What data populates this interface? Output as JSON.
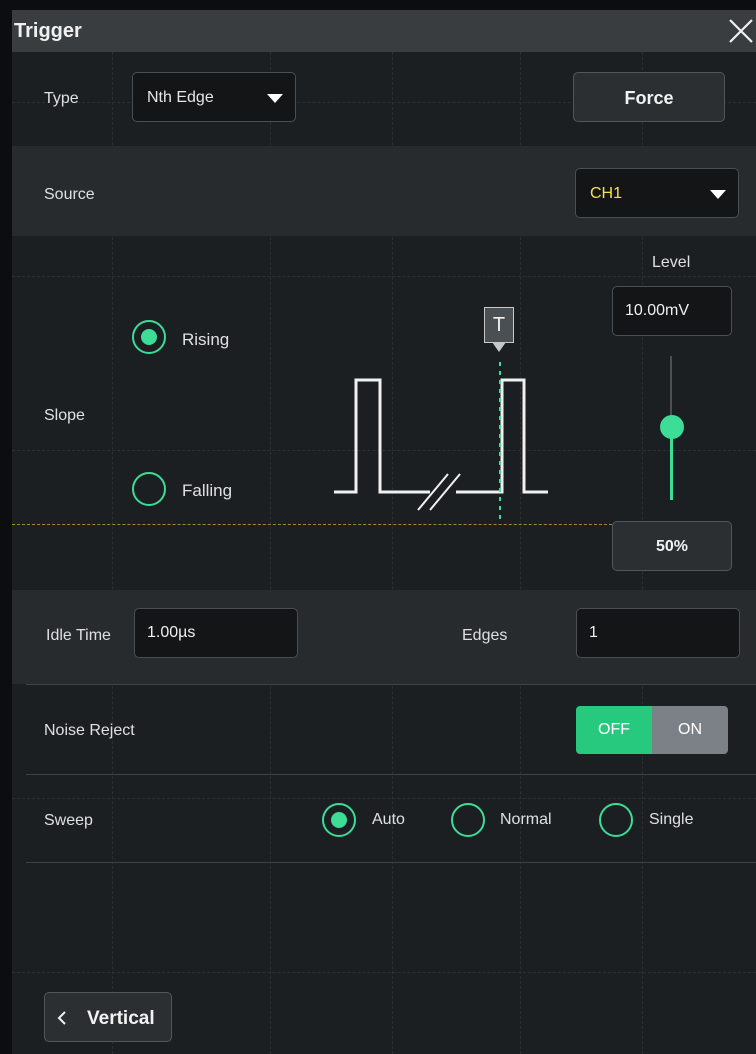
{
  "title": "Trigger",
  "type": {
    "label": "Type",
    "value": "Nth Edge"
  },
  "force_label": "Force",
  "source": {
    "label": "Source",
    "value": "CH1",
    "value_color": "#f4e04d"
  },
  "slope": {
    "label": "Slope",
    "options": [
      {
        "label": "Rising",
        "selected": true
      },
      {
        "label": "Falling",
        "selected": false
      }
    ]
  },
  "diagram_marker": "T",
  "level": {
    "label": "Level",
    "value": "10.00mV",
    "percent_label": "50%",
    "slider_fraction": 0.5
  },
  "idle_time": {
    "label": "Idle Time",
    "value": "1.00µs"
  },
  "edges": {
    "label": "Edges",
    "value": "1"
  },
  "noise_reject": {
    "label": "Noise Reject",
    "off_label": "OFF",
    "on_label": "ON",
    "state": "OFF"
  },
  "sweep": {
    "label": "Sweep",
    "options": [
      {
        "label": "Auto",
        "selected": true
      },
      {
        "label": "Normal",
        "selected": false
      },
      {
        "label": "Single",
        "selected": false
      }
    ]
  },
  "back_button": {
    "label": "Vertical"
  },
  "colors": {
    "accent": "#3ddc97",
    "panel": "#1c1f22",
    "titlebar": "#3a3d40",
    "source_text": "#f4e04d"
  }
}
